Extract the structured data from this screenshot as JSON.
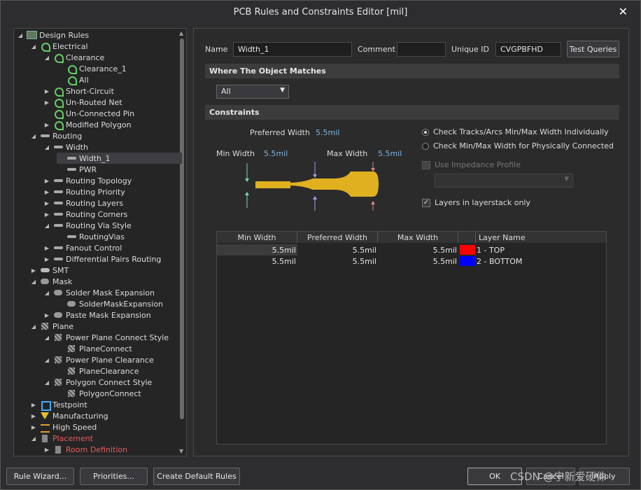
{
  "window": {
    "title": "PCB Rules and Constraints Editor [mil]"
  },
  "tree": [
    {
      "label": "Design Rules",
      "icon": "design-rules-icon",
      "level": 0,
      "arrow": "open"
    },
    {
      "label": "Electrical",
      "icon": "electrical-icon",
      "level": 1,
      "arrow": "open"
    },
    {
      "label": "Clearance",
      "icon": "electrical-icon",
      "level": 2,
      "arrow": "open"
    },
    {
      "label": "Clearance_1",
      "icon": "electrical-icon",
      "level": 3,
      "arrow": ""
    },
    {
      "label": "All",
      "icon": "electrical-icon",
      "level": 3,
      "arrow": ""
    },
    {
      "label": "Short-Circuit",
      "icon": "electrical-icon",
      "level": 2,
      "arrow": "closed"
    },
    {
      "label": "Un-Routed Net",
      "icon": "electrical-icon",
      "level": 2,
      "arrow": "closed"
    },
    {
      "label": "Un-Connected Pin",
      "icon": "electrical-icon",
      "level": 2,
      "arrow": ""
    },
    {
      "label": "Modified Polygon",
      "icon": "electrical-icon",
      "level": 2,
      "arrow": "closed"
    },
    {
      "label": "Routing",
      "icon": "routing-icon",
      "level": 1,
      "arrow": "open"
    },
    {
      "label": "Width",
      "icon": "routing-icon",
      "level": 2,
      "arrow": "open"
    },
    {
      "label": "Width_1",
      "icon": "routing-icon",
      "level": 3,
      "arrow": "",
      "selected": true
    },
    {
      "label": "PWR",
      "icon": "routing-icon",
      "level": 3,
      "arrow": ""
    },
    {
      "label": "Routing Topology",
      "icon": "routing-icon",
      "level": 2,
      "arrow": "closed"
    },
    {
      "label": "Routing Priority",
      "icon": "routing-icon",
      "level": 2,
      "arrow": "closed"
    },
    {
      "label": "Routing Layers",
      "icon": "routing-icon",
      "level": 2,
      "arrow": "closed"
    },
    {
      "label": "Routing Corners",
      "icon": "routing-icon",
      "level": 2,
      "arrow": "closed"
    },
    {
      "label": "Routing Via Style",
      "icon": "routing-icon",
      "level": 2,
      "arrow": "open"
    },
    {
      "label": "RoutingVias",
      "icon": "routing-icon",
      "level": 3,
      "arrow": ""
    },
    {
      "label": "Fanout Control",
      "icon": "routing-icon",
      "level": 2,
      "arrow": "closed"
    },
    {
      "label": "Differential Pairs Routing",
      "icon": "routing-icon",
      "level": 2,
      "arrow": "closed"
    },
    {
      "label": "SMT",
      "icon": "smt-icon",
      "level": 1,
      "arrow": "closed"
    },
    {
      "label": "Mask",
      "icon": "mask-icon",
      "level": 1,
      "arrow": "open"
    },
    {
      "label": "Solder Mask Expansion",
      "icon": "mask-icon",
      "level": 2,
      "arrow": "open"
    },
    {
      "label": "SolderMaskExpansion",
      "icon": "mask-icon",
      "level": 3,
      "arrow": ""
    },
    {
      "label": "Paste Mask Expansion",
      "icon": "mask-icon",
      "level": 2,
      "arrow": "closed"
    },
    {
      "label": "Plane",
      "icon": "plane-icon",
      "level": 1,
      "arrow": "open"
    },
    {
      "label": "Power Plane Connect Style",
      "icon": "plane-icon",
      "level": 2,
      "arrow": "open"
    },
    {
      "label": "PlaneConnect",
      "icon": "plane-icon",
      "level": 3,
      "arrow": ""
    },
    {
      "label": "Power Plane Clearance",
      "icon": "plane-icon",
      "level": 2,
      "arrow": "open"
    },
    {
      "label": "PlaneClearance",
      "icon": "plane-icon",
      "level": 3,
      "arrow": ""
    },
    {
      "label": "Polygon Connect Style",
      "icon": "plane-icon",
      "level": 2,
      "arrow": "open"
    },
    {
      "label": "PolygonConnect",
      "icon": "plane-icon",
      "level": 3,
      "arrow": ""
    },
    {
      "label": "Testpoint",
      "icon": "testpoint-icon",
      "level": 1,
      "arrow": "closed"
    },
    {
      "label": "Manufacturing",
      "icon": "manufacturing-icon",
      "level": 1,
      "arrow": "closed"
    },
    {
      "label": "High Speed",
      "icon": "high-speed-icon",
      "level": 1,
      "arrow": "closed"
    },
    {
      "label": "Placement",
      "icon": "placement-icon",
      "level": 1,
      "arrow": "open",
      "red": true
    },
    {
      "label": "Room Definition",
      "icon": "placement-icon",
      "level": 2,
      "arrow": "closed",
      "red": true
    }
  ],
  "form": {
    "name_label": "Name",
    "name_value": "Width_1",
    "comment_label": "Comment",
    "comment_value": "",
    "uid_label": "Unique ID",
    "uid_value": "CVGPBFHD",
    "test_queries": "Test Queries"
  },
  "where": {
    "header": "Where The Object Matches",
    "selected": "All"
  },
  "constraints": {
    "header": "Constraints",
    "preferred_label": "Preferred Width",
    "preferred_value": "5.5mil",
    "min_label": "Min Width",
    "min_value": "5.5mil",
    "max_label": "Max Width",
    "max_value": "5.5mil",
    "radio1": "Check Tracks/Arcs Min/Max Width Individually",
    "radio2": "Check Min/Max Width for Physically Connected",
    "impedance": "Use Impedance Profile",
    "layers_only": "Layers in layerstack only"
  },
  "table": {
    "headers": [
      "Min Width",
      "Preferred Width",
      "Max Width",
      "",
      "Layer Name"
    ],
    "rows": [
      {
        "min": "5.5mil",
        "pref": "5.5mil",
        "max": "5.5mil",
        "color": "#ff0000",
        "layer": "1 - TOP"
      },
      {
        "min": "5.5mil",
        "pref": "5.5mil",
        "max": "5.5mil",
        "color": "#0000ff",
        "layer": "2 - BOTTOM"
      }
    ]
  },
  "buttons": {
    "wizard": "Rule Wizard...",
    "priorities": "Priorities...",
    "defaults": "Create Default Rules",
    "ok": "OK",
    "cancel": "Cancel",
    "apply": "Apply"
  },
  "watermark": "CSDN @宁新爱硬件",
  "colors": {
    "accent_track": "#e0b020",
    "label_blue": "#7ab4e0"
  }
}
